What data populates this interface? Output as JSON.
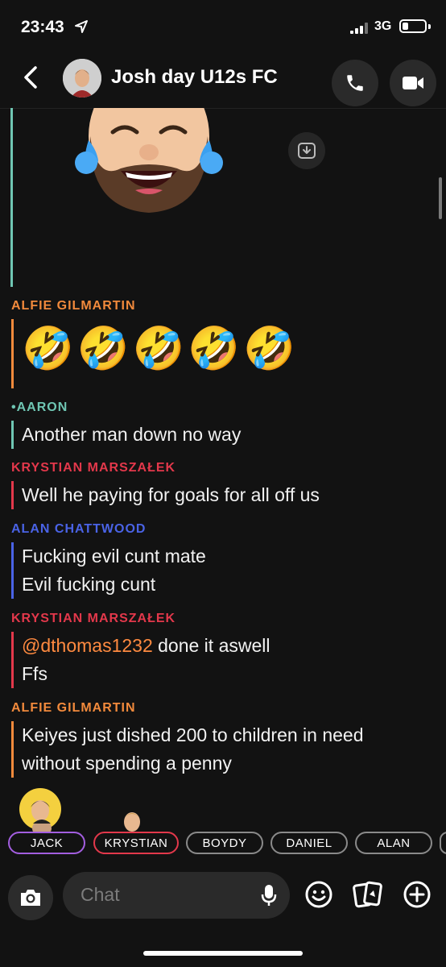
{
  "status": {
    "time": "23:43",
    "network": "3G",
    "battery_level": 0.25
  },
  "header": {
    "title": "Josh day U12s FC"
  },
  "messages": [
    {
      "sender": "ALFIE GILMARTIN",
      "color": "#f28a3c",
      "emoji": [
        "🤣",
        "🤣",
        "🤣",
        "🤣",
        "🤣"
      ]
    },
    {
      "sender": "•AARON",
      "color": "#6fc6b3",
      "lines": [
        "Another man down no way"
      ]
    },
    {
      "sender": "KRYSTIAN MARSZAŁEK",
      "color": "#e3384b",
      "lines": [
        "Well he paying for goals for all off us"
      ]
    },
    {
      "sender": "ALAN CHATTWOOD",
      "color": "#4a63e6",
      "lines": [
        "Fucking evil cunt mate",
        "Evil fucking cunt"
      ]
    },
    {
      "sender": "KRYSTIAN MARSZAŁEK",
      "color": "#e3384b",
      "mention": "@dthomas1232",
      "lines": [
        " done it aswell",
        "Ffs"
      ]
    },
    {
      "sender": "ALFIE GILMARTIN",
      "color": "#f28a3c",
      "lines": [
        "Keiyes just dished 200 to children in need",
        "without spending a penny"
      ]
    }
  ],
  "chips": [
    {
      "label": "JACK",
      "color": "#a35ee0"
    },
    {
      "label": "KRYSTIAN",
      "color": "#e3384b"
    },
    {
      "label": "BOYDY",
      "color": "#8a8a8a"
    },
    {
      "label": "DANIEL",
      "color": "#8a8a8a"
    },
    {
      "label": "ALAN",
      "color": "#8a8a8a"
    }
  ],
  "composer": {
    "placeholder": "Chat"
  },
  "icons": {
    "back": "chevron-left-icon",
    "call": "phone-icon",
    "video": "video-camera-icon",
    "save": "save-message-icon",
    "camera": "camera-icon",
    "mic": "microphone-icon",
    "emoji": "smiley-icon",
    "stickers": "stickers-icon",
    "plus": "plus-icon"
  }
}
